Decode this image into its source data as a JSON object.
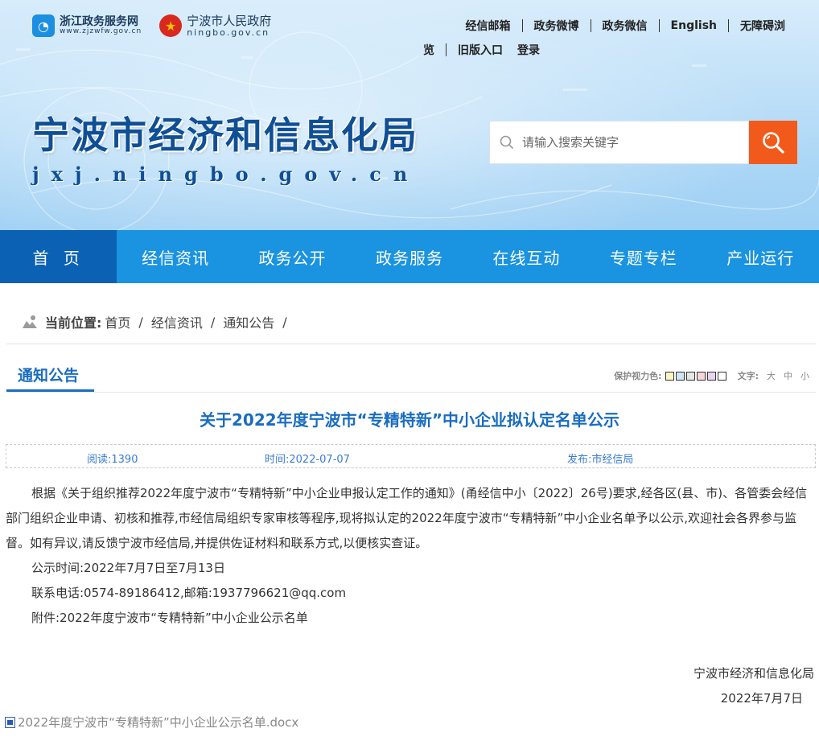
{
  "header": {
    "logo_zj": {
      "name": "浙江政务服务网",
      "url_text": "www.zjzwfw.gov.cn"
    },
    "logo_nb": {
      "name": "宁波市人民政府",
      "url_text": "ningbo.gov.cn"
    },
    "top_links": [
      "经信邮箱",
      "政务微博",
      "政务微信",
      "English",
      "无障碍浏"
    ],
    "top_links_row2": [
      "览",
      "旧版入口",
      "登录"
    ],
    "site_title": "宁波市经济和信息化局",
    "site_domain": "jxj.ningbo.gov.cn",
    "search": {
      "placeholder": "请输入搜索关键字"
    }
  },
  "nav": {
    "items": [
      "首 页",
      "经信资讯",
      "政务公开",
      "政务服务",
      "在线互动",
      "专题专栏",
      "产业运行"
    ],
    "active_index": 0
  },
  "breadcrumb": {
    "label": "当前位置:",
    "items": [
      "首页",
      "经信资讯",
      "通知公告"
    ]
  },
  "section": {
    "title": "通知公告",
    "eye_care_label": "保护视力色:",
    "swatches": [
      "#fbf5c4",
      "#cfe6f5",
      "#e6e6e6",
      "#f8d7dc",
      "#e6d6f2",
      "#ffffff"
    ],
    "font_label": "文字:",
    "font_options": [
      "大",
      "中",
      "小"
    ]
  },
  "article": {
    "title": "关于2022年度宁波市“专精特新”中小企业拟认定名单公示",
    "meta": {
      "reads": "阅读:1390",
      "time": "时间:2022-07-07",
      "publisher": "发布:市经信局"
    },
    "paragraphs": [
      "根据《关于组织推荐2022年度宁波市“专精特新”中小企业申报认定工作的通知》(甬经信中小〔2022〕26号)要求,经各区(县、市)、各管委会经信部门组织企业申请、初核和推荐,市经信局组织专家审核等程序,现将拟认定的2022年度宁波市“专精特新”中小企业名单予以公示,欢迎社会各界参与监督。如有异议,请反馈宁波市经信局,并提供佐证材料和联系方式,以便核实查证。",
      "公示时间:2022年7月7日至7月13日",
      "联系电话:0574-89186412,邮箱:1937796621@qq.com",
      "附件:2022年度宁波市“专精特新”中小企业公示名单"
    ],
    "signature": "宁波市经济和信息化局",
    "sign_date": "2022年7月7日",
    "attachment": "2022年度宁波市“专精特新”中小企业公示名单.docx"
  },
  "colors": {
    "nav_bg": "#1a93e0",
    "nav_active": "#0b62b5",
    "accent": "#1a6dc0",
    "search_button": "#f25a1c"
  }
}
